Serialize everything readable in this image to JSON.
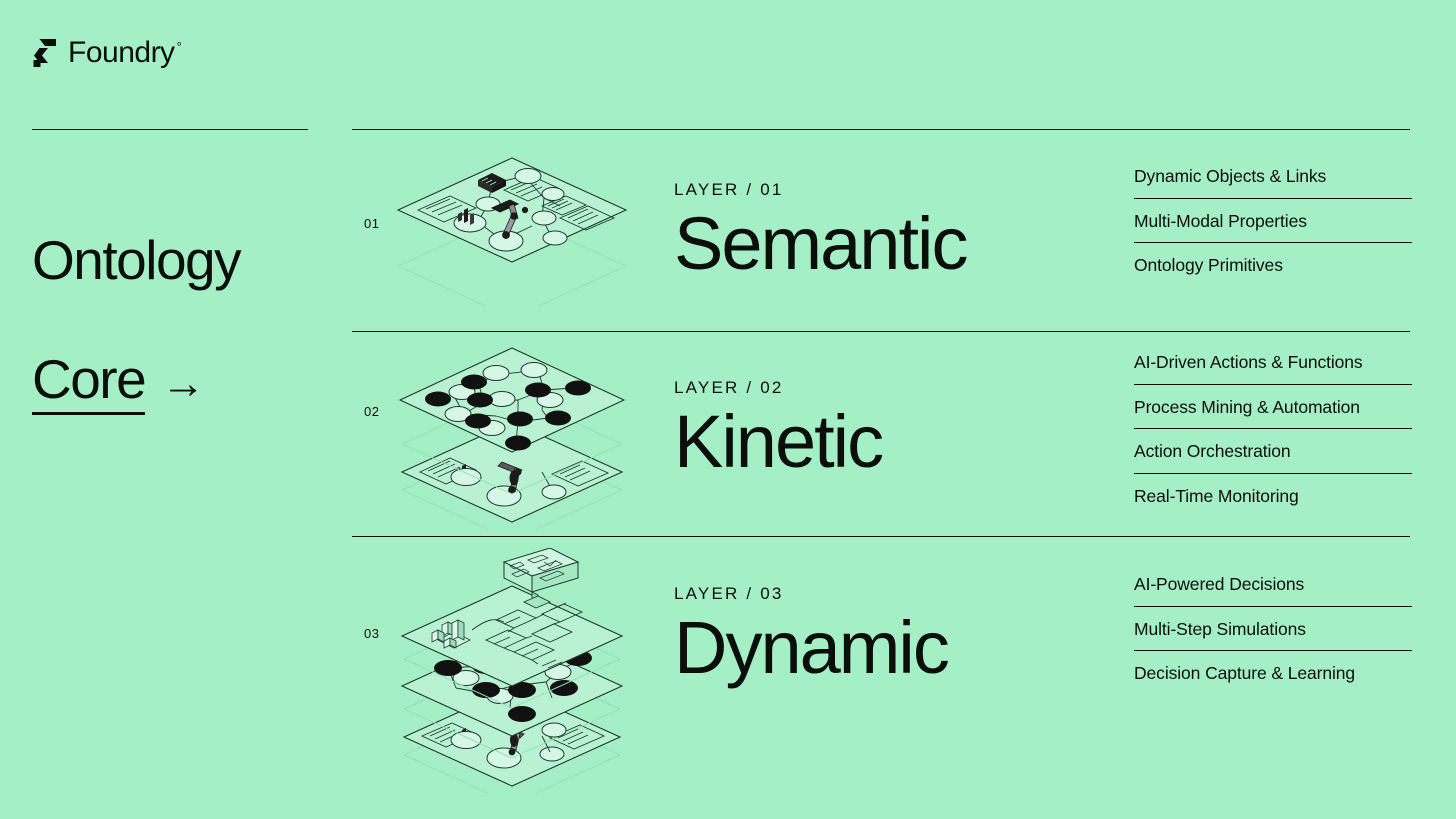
{
  "brand": {
    "name": "Foundry",
    "degree_symbol": "°",
    "mark_icon": "foundry-f-mark-icon"
  },
  "headline": {
    "line1": "Ontology",
    "line2": "Core",
    "arrow": "→"
  },
  "colors": {
    "background": "#a5efc6",
    "ink": "#0b0f0c",
    "plane_fill": "#bdf3d6",
    "plane_stroke": "#1d3a2b",
    "node_dark": "#111111"
  },
  "rows": [
    {
      "index": "01",
      "eyebrow": "LAYER / 01",
      "title": "Semantic",
      "illustration": "isometric-single-plane-ontology",
      "features": [
        "Dynamic Objects & Links",
        "Multi-Modal Properties",
        "Ontology Primitives"
      ]
    },
    {
      "index": "02",
      "eyebrow": "LAYER / 02",
      "title": "Kinetic",
      "illustration": "isometric-two-plane-network",
      "features": [
        "AI-Driven Actions & Functions",
        "Process Mining & Automation",
        "Action Orchestration",
        "Real-Time Monitoring"
      ]
    },
    {
      "index": "03",
      "eyebrow": "LAYER / 03",
      "title": "Dynamic",
      "illustration": "isometric-three-plane-simulation",
      "features": [
        "AI-Powered Decisions",
        "Multi-Step Simulations",
        "Decision Capture & Learning"
      ]
    }
  ]
}
